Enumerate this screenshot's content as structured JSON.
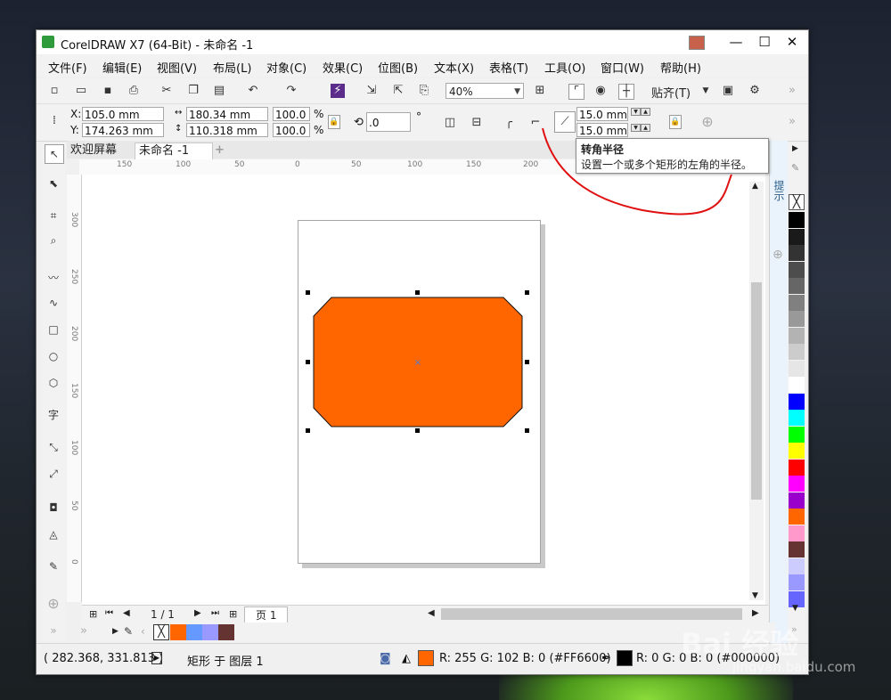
{
  "window": {
    "title": "CorelDRAW X7 (64-Bit) - 未命名 -1",
    "min": "—",
    "max": "☐",
    "close": "✕"
  },
  "menu": [
    "文件(F)",
    "编辑(E)",
    "视图(V)",
    "布局(L)",
    "对象(C)",
    "效果(C)",
    "位图(B)",
    "文本(X)",
    "表格(T)",
    "工具(O)",
    "窗口(W)",
    "帮助(H)"
  ],
  "toolbar": {
    "zoom": "40%",
    "snap": "贴齐(T)"
  },
  "props": {
    "x_label": "X:",
    "x": "105.0 mm",
    "y_label": "Y:",
    "y": "174.263 mm",
    "width": "180.34 mm",
    "height": "110.318 mm",
    "scale_x": "100.0",
    "scale_y": "100.0",
    "pct": "%",
    "rotation": ".0",
    "degree": "°",
    "corner_radius_1": "15.0 mm",
    "corner_radius_2": "15.0 mm"
  },
  "tabs": {
    "welcome": "欢迎屏幕",
    "document": "未命名 -1",
    "add": "+"
  },
  "ruler": {
    "h": [
      "150",
      "100",
      "50",
      "0",
      "50",
      "100",
      "150",
      "200"
    ],
    "v": [
      "300",
      "250",
      "200",
      "150",
      "100",
      "50",
      "0"
    ]
  },
  "tooltip": {
    "title": "转角半径",
    "desc": "设置一个或多个矩形的左角的半径。"
  },
  "docker": {
    "label": "提示"
  },
  "page_nav": {
    "pages": "1 / 1",
    "page_tab": "页 1"
  },
  "status": {
    "coords": "( 282.368, 331.813 )",
    "object": "矩形 于 图层 1",
    "fill_color_hex": "#FF6600",
    "fill": "R: 255 G: 102 B: 0 (#FF6600)",
    "outline_color_hex": "#000000",
    "outline": "R: 0 G: 0 B: 0 (#000000)"
  },
  "palette": [
    "#000000",
    "#1a1a1a",
    "#333333",
    "#4d4d4d",
    "#666666",
    "#808080",
    "#999999",
    "#b3b3b3",
    "#cccccc",
    "#e6e6e6",
    "#ffffff",
    "#0000ff",
    "#00ffff",
    "#00ff00",
    "#ffff00",
    "#ff0000",
    "#ff00ff",
    "#9900cc",
    "#ff6600",
    "#ff99cc",
    "#663333",
    "#ccccff",
    "#9999ff",
    "#6666ff"
  ],
  "doc_palette": [
    "#ff6600",
    "#6699ff",
    "#9999ff",
    "#663333"
  ],
  "watermark": {
    "brand": "Bai 经验",
    "url": "jingyan.baidu.com"
  }
}
